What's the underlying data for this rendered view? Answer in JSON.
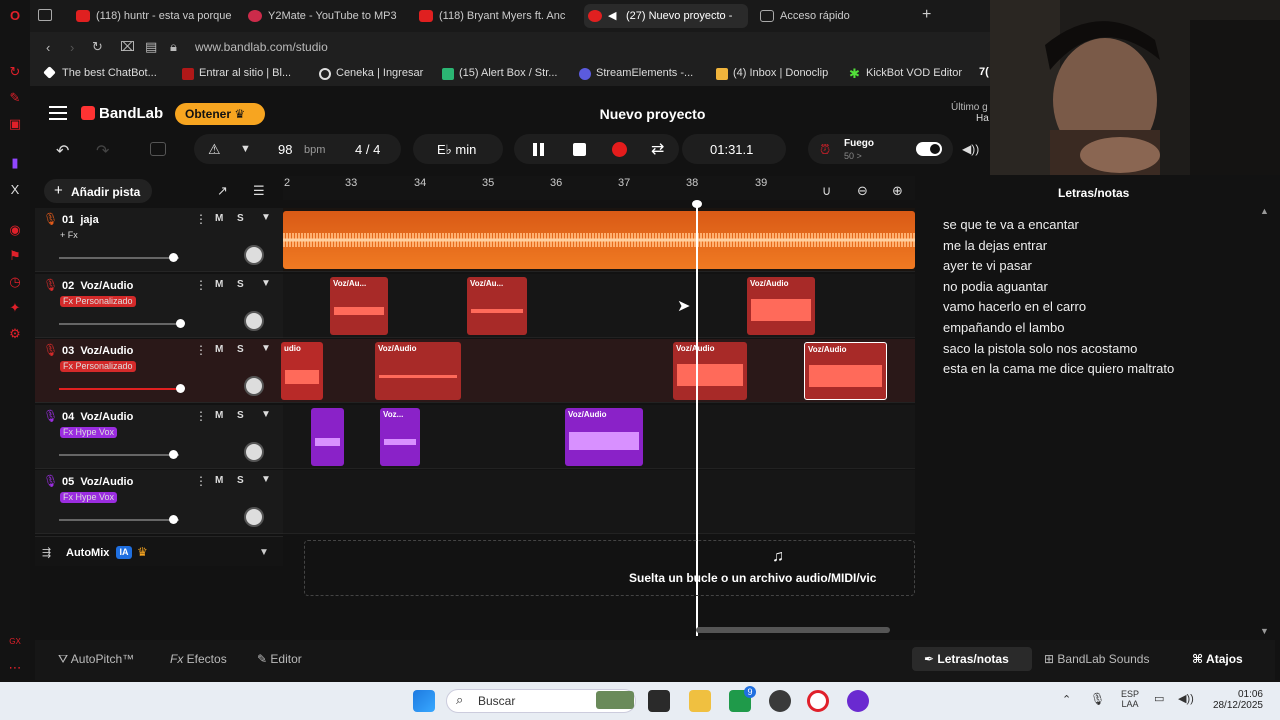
{
  "browser": {
    "tabs": [
      {
        "label": "(118) huntr - esta va porque",
        "color": "#e02020",
        "active": false
      },
      {
        "label": "Y2Mate - YouTube to MP3",
        "color": "#cc2b4a",
        "active": false
      },
      {
        "label": "(118) Bryant Myers ft. Anc",
        "color": "#e02020",
        "active": false
      },
      {
        "label": "(27) Nuevo proyecto -",
        "color": "#e02020",
        "active": true
      },
      {
        "label": "Acceso rápido",
        "color": "#888888",
        "active": false
      }
    ],
    "url": "www.bandlab.com/studio",
    "bookmarks": [
      {
        "label": "The best ChatBot...",
        "color": "#ffffff"
      },
      {
        "label": "Entrar al sitio | Bl...",
        "color": "#b01818"
      },
      {
        "label": "Ceneka | Ingresar",
        "color": "#dddddd"
      },
      {
        "label": "(15) Alert Box / Str...",
        "color": "#2bb673"
      },
      {
        "label": "StreamElements -...",
        "color": "#5b5bde"
      },
      {
        "label": "(4) Inbox | Donoclip",
        "color": "#f0b43c"
      },
      {
        "label": "KickBot VOD Editor",
        "color": "#52e13a"
      }
    ]
  },
  "app": {
    "logo": "BandLab",
    "obtener": "Obtener",
    "project_title": "Nuevo proyecto",
    "last_saved_line1": "Último g",
    "last_saved_line2": "Ha",
    "bpm_value": "98",
    "bpm_unit": "bpm",
    "time_sig": "4 / 4",
    "key": "E♭ min",
    "time": "01:31.1",
    "fuego_label": "Fuego",
    "fuego_sub": "50 >",
    "add_track": "Añadir pista",
    "ruler": [
      "2",
      "33",
      "34",
      "35",
      "36",
      "37",
      "38",
      "39"
    ],
    "tracks": [
      {
        "num": "01",
        "name": "jaja",
        "fx": "+ Fx",
        "fx_color": "transparent",
        "mic_color": "#e05a1a",
        "vol": 0.72,
        "sel": false
      },
      {
        "num": "02",
        "name": "Voz/Audio",
        "fx": "Fx Personalizado",
        "fx_color": "#d42a2a",
        "mic_color": "#d42a2a",
        "vol": 0.78,
        "sel": false
      },
      {
        "num": "03",
        "name": "Voz/Audio",
        "fx": "Fx Personalizado",
        "fx_color": "#d42a2a",
        "mic_color": "#d42a2a",
        "vol": 0.78,
        "sel": true
      },
      {
        "num": "04",
        "name": "Voz/Audio",
        "fx": "Fx Hype Vox",
        "fx_color": "#9b2de0",
        "mic_color": "#9b2de0",
        "vol": 0.72,
        "sel": false
      },
      {
        "num": "05",
        "name": "Voz/Audio",
        "fx": "Fx Hype Vox",
        "fx_color": "#9b2de0",
        "mic_color": "#9b2de0",
        "vol": 0.72,
        "sel": false
      }
    ],
    "m": "M",
    "s": "S",
    "automix": "AutoMix",
    "automix_badge": "IA",
    "drop_text": "Suelta un bucle o un archivo audio/MIDI/vic",
    "clip_labels": {
      "c2": "Voz/Au...",
      "c3": "Voz/Audio",
      "c4": "Voz/Audio",
      "c5": "Voz...",
      "c6": "udio"
    },
    "lyrics_title": "Letras/notas",
    "lyrics": [
      "se que te va a encantar",
      "me la dejas  entrar",
      "ayer te vi pasar",
      "no podia aguantar",
      "vamo hacerlo en el carro",
      "empañando el lambo",
      "saco la pistola solo nos acostamo",
      "esta en la  cama me dice quiero maltrato"
    ],
    "bottom": {
      "autopitch": "AutoPitch™",
      "efectos": "Efectos",
      "editor": "Editor",
      "letras": "Letras/notas",
      "sounds": "BandLab Sounds",
      "atajos": "Atajos"
    }
  },
  "taskbar": {
    "search": "Buscar",
    "lang1": "ESP",
    "lang2": "LAA",
    "time": "01:06",
    "date": "28/12/2025",
    "badge": "9"
  },
  "colors": {
    "orange": "#e8631a",
    "red": "#c0282a",
    "purple": "#9b2de0",
    "accent": "#f7a520"
  }
}
